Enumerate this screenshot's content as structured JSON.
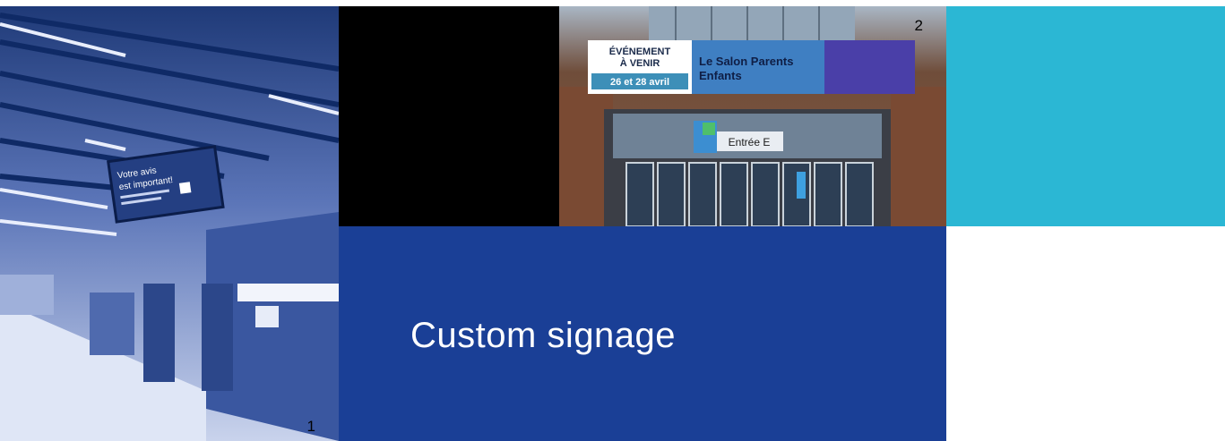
{
  "tiles": {
    "left_photo": {
      "number": "1",
      "screen_text_line1": "Votre avis",
      "screen_text_line2": "est important!"
    },
    "right_photo": {
      "number": "2",
      "banner": {
        "left_line1": "ÉVÉNEMENT",
        "left_line2": "À VENIR",
        "dates": "26 et 28 avril",
        "title_line1": "Le Salon Parents",
        "title_line2": "Enfants"
      },
      "entrance_sign": "Entrée E"
    }
  },
  "panel": {
    "title": "Custom signage"
  },
  "colors": {
    "panel_blue": "#1a3f96",
    "cyan": "#2bb7d4",
    "black": "#000000"
  }
}
